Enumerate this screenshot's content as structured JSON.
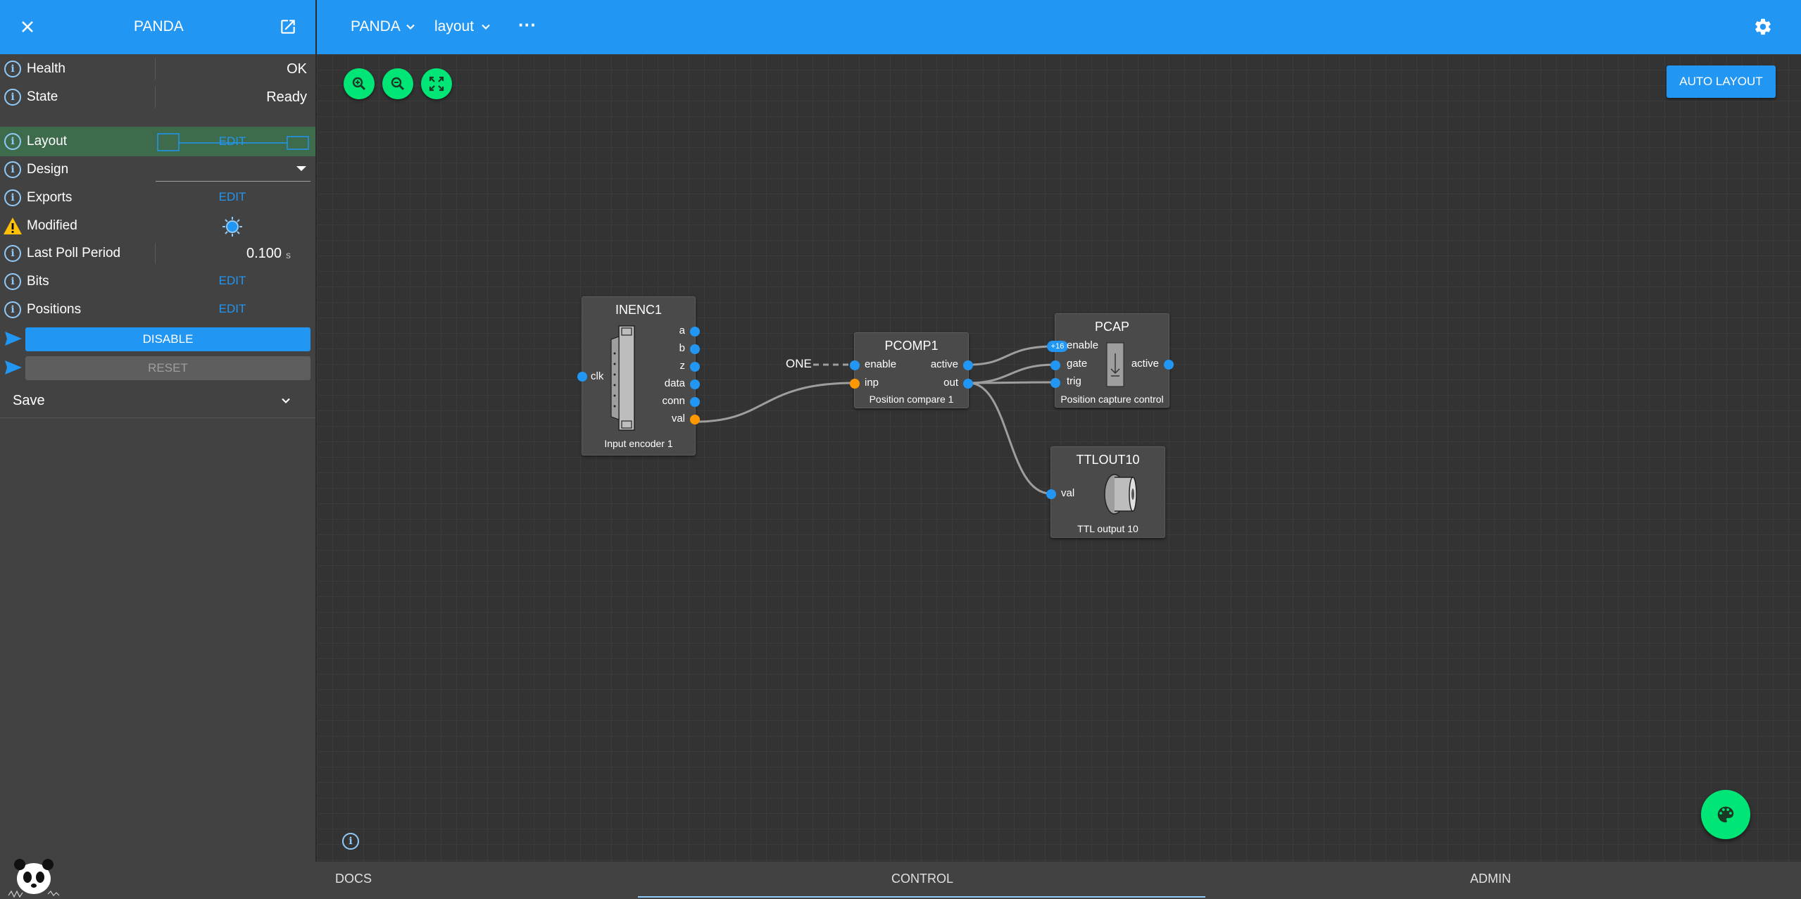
{
  "left_header": {
    "title": "PANDA"
  },
  "main_header": {
    "crumb1": "PANDA",
    "crumb2": "layout",
    "more": "···"
  },
  "attributes": [
    {
      "label": "Health",
      "value": "OK",
      "icon": "info-icon"
    },
    {
      "label": "State",
      "value": "Ready",
      "icon": "info-icon"
    },
    {
      "label": "Layout",
      "value": "EDIT",
      "icon": "info-icon"
    },
    {
      "label": "Design",
      "value": "",
      "icon": "info-icon"
    },
    {
      "label": "Exports",
      "value": "EDIT",
      "icon": "info-icon"
    },
    {
      "label": "Modified",
      "value": "",
      "icon": "warning-icon"
    },
    {
      "label": "Last Poll Period",
      "value": "0.100",
      "unit": "s",
      "icon": "info-icon"
    },
    {
      "label": "Bits",
      "value": "EDIT",
      "icon": "info-icon"
    },
    {
      "label": "Positions",
      "value": "EDIT",
      "icon": "info-icon"
    }
  ],
  "methods": {
    "disable": "DISABLE",
    "reset": "RESET"
  },
  "save": {
    "label": "Save"
  },
  "toolbar": {
    "auto_layout": "AUTO LAYOUT"
  },
  "blocks": {
    "inenc1": {
      "title": "INENC1",
      "desc": "Input encoder 1",
      "in_ports": [
        "clk"
      ],
      "out_ports": [
        "a",
        "b",
        "z",
        "data",
        "conn",
        "val"
      ]
    },
    "pcomp1": {
      "title": "PCOMP1",
      "desc": "Position compare 1",
      "in_ports": [
        "enable",
        "inp"
      ],
      "out_ports": [
        "active",
        "out"
      ],
      "const_label": "ONE"
    },
    "pcap": {
      "title": "PCAP",
      "desc": "Position capture control",
      "in_ports": [
        "enable",
        "gate",
        "trig"
      ],
      "out_ports": [
        "active"
      ],
      "badge": "+16"
    },
    "ttlout10": {
      "title": "TTLOUT10",
      "desc": "TTL output 10",
      "in_ports": [
        "val"
      ]
    }
  },
  "tabs": {
    "docs": "DOCS",
    "control": "CONTROL",
    "admin": "ADMIN"
  },
  "colors": {
    "primary": "#2196f3",
    "accent": "#00e676",
    "warning": "#ffc107",
    "port_orange": "#ff9800"
  }
}
